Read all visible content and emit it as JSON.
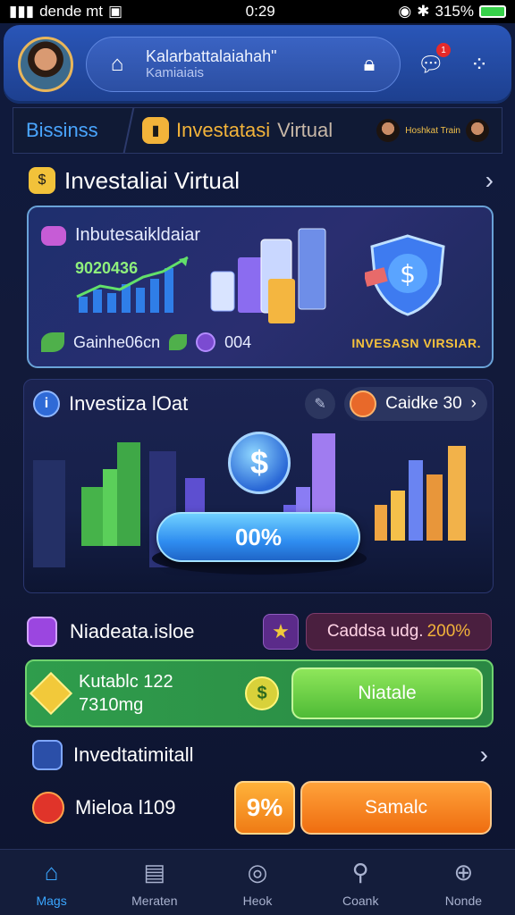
{
  "status_bar": {
    "left_text": "dende mt",
    "time": "0:29",
    "battery_text": "315%"
  },
  "header": {
    "search_line1": "Kalarbattalaiahah\"",
    "search_line2": "Kamiaiais",
    "notification_count": "1"
  },
  "tabs": {
    "business": "Bissinss",
    "investasi": "Investatasi",
    "virtual": "Virtual",
    "mini_text": "Hoshkat Train"
  },
  "section_title": "Investaliai Virtual",
  "card1": {
    "title": "Inbutesaikldaiar",
    "value": "9020436",
    "bottom_label": "Gainhe06cn",
    "bottom_value": "004",
    "brand": "INVESASN VIRSIAR."
  },
  "card2": {
    "title": "Investiza lOat",
    "pill_label": "Caidke 30",
    "progress_label": "00%"
  },
  "row3": {
    "label": "Niadeata.isloe",
    "credit_label": "Caddsa udg.",
    "credit_pct": "200%"
  },
  "green": {
    "line1": "Kutablc 122",
    "line2": "7310mg",
    "button": "Niatale"
  },
  "row5": {
    "label": "Invedtatimitall"
  },
  "row6": {
    "label": "Mieloa l109",
    "pct_button": "9%",
    "button": "Samalc"
  },
  "nav": [
    {
      "label": "Mags",
      "icon": "home-icon"
    },
    {
      "label": "Meraten",
      "icon": "document-icon"
    },
    {
      "label": "Heok",
      "icon": "compass-icon"
    },
    {
      "label": "Coank",
      "icon": "search-icon"
    },
    {
      "label": "Nonde",
      "icon": "target-icon"
    }
  ],
  "colors": {
    "accent_blue": "#3aa6ff",
    "accent_orange": "#ef7b15",
    "accent_green": "#4fbb36",
    "gold": "#f2b33a"
  }
}
